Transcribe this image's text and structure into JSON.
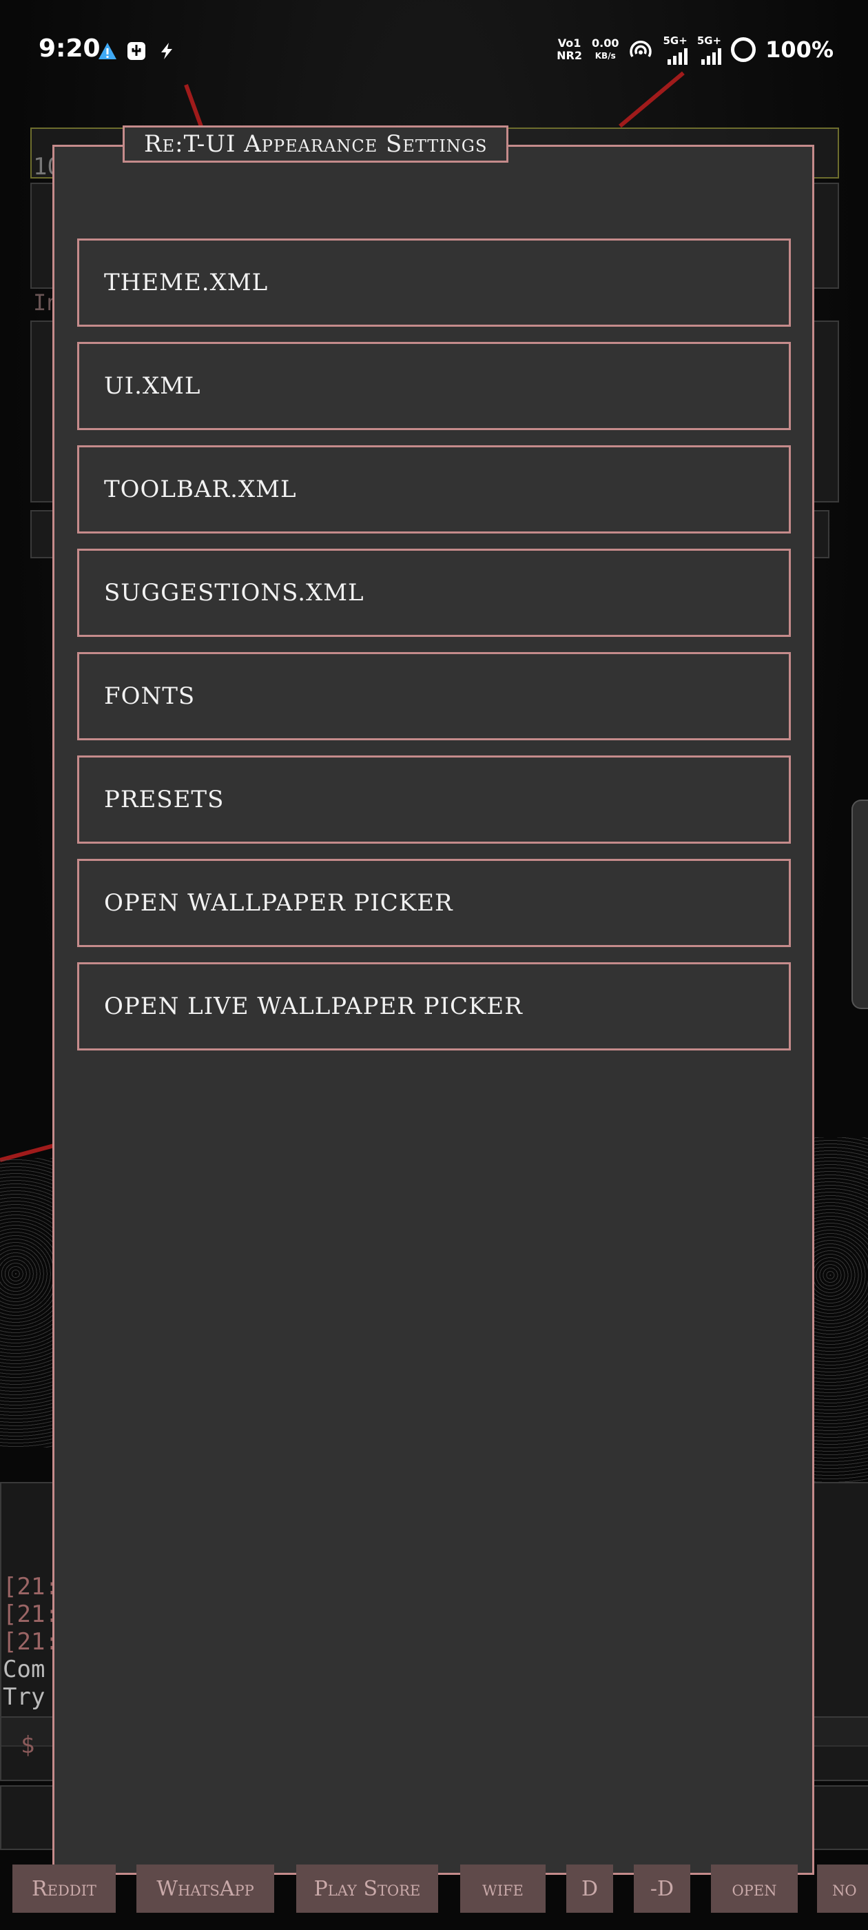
{
  "status_bar": {
    "time": "9:20",
    "network_top": "Vo1",
    "network_bottom": "NR2",
    "speed_top": "0.00",
    "speed_bottom": "KB/s",
    "sim1": "5G+",
    "sim2": "5G+",
    "battery": "100%"
  },
  "background": {
    "log_lines": [
      "[21:",
      "[21:",
      "[21:",
      "Com",
      "Try"
    ],
    "prompt": "$ ",
    "fragment_top": "10",
    "fragment_in": "In"
  },
  "dialog": {
    "title": "Re:T-UI Appearance Settings",
    "options": [
      "THEME.XML",
      "UI.XML",
      "TOOLBAR.XML",
      "SUGGESTIONS.XML",
      "FONTS",
      "PRESETS",
      "OPEN WALLPAPER PICKER",
      "OPEN LIVE WALLPAPER PICKER"
    ]
  },
  "toolbar": {
    "buttons": [
      "Reddit",
      "WhatsApp",
      "Play Store",
      "wife",
      "D",
      "-D",
      "open",
      "no"
    ]
  }
}
